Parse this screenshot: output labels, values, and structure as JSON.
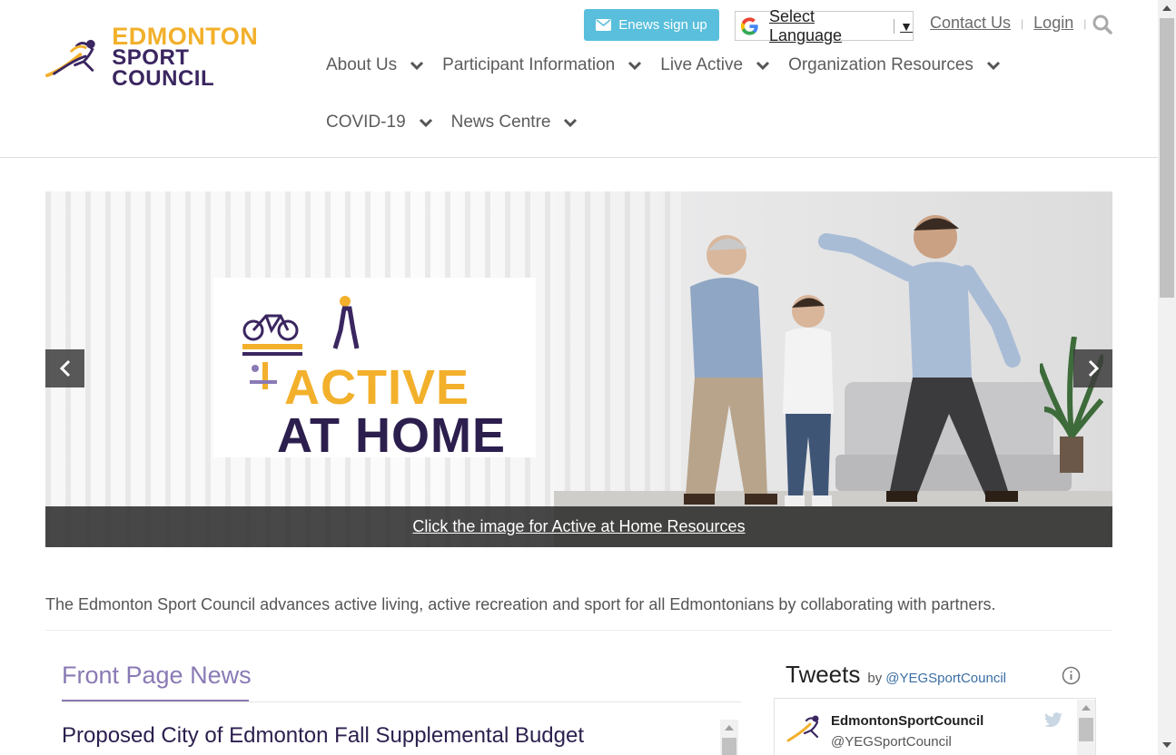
{
  "brand": {
    "line1": "EDMONTON",
    "line2": "SPORT COUNCIL",
    "primary_color": "#f2b02b",
    "secondary_color": "#3a2660"
  },
  "header": {
    "enews_label": "Enews sign up",
    "language_label": "Select Language",
    "language_arrow": "▼",
    "contact_label": "Contact Us",
    "login_label": "Login",
    "sep": "|"
  },
  "nav": {
    "row1": [
      {
        "label": "About Us"
      },
      {
        "label": "Participant Information"
      },
      {
        "label": "Live Active"
      },
      {
        "label": "Organization Resources"
      }
    ],
    "row2": [
      {
        "label": "COVID-19"
      },
      {
        "label": "News Centre"
      }
    ]
  },
  "slider": {
    "promo_line1": "ACTIVE",
    "promo_line2": "AT HOME",
    "caption": "Click the image for Active at Home Resources",
    "prev_icon": "chevron-left-icon",
    "next_icon": "chevron-right-icon"
  },
  "intro": {
    "text": "The Edmonton Sport Council advances active living, active recreation and sport for all Edmontonians by collaborating with partners."
  },
  "news": {
    "heading": "Front Page News",
    "first_title": "Proposed City of Edmonton Fall Supplemental Budget Adjustments"
  },
  "tweets": {
    "title": "Tweets",
    "by": "by",
    "handle_link": "@YEGSportCouncil",
    "first_name": "EdmontonSportCouncil",
    "first_handle": "@YEGSportCouncil"
  },
  "colors": {
    "enews_bg": "#59bfdc",
    "heading_purple": "#8a7ab5",
    "title_purple": "#2c1f4e"
  }
}
